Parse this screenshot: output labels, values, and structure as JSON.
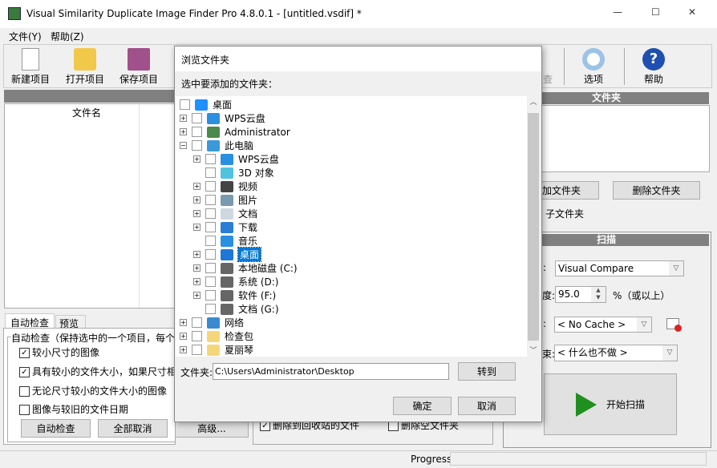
{
  "window": {
    "title": "Visual Similarity Duplicate Image Finder Pro 4.8.0.1 - [untitled.vsdif] *",
    "minimize": "—",
    "maximize": "☐",
    "close": "✕"
  },
  "menu": [
    "文件(Y)",
    "帮助(Z)"
  ],
  "toolbar": {
    "new": "新建项目",
    "open": "打开项目",
    "save": "保存项目",
    "check": "检查",
    "options": "选项",
    "help": "帮助"
  },
  "left": {
    "column_header": "文件名",
    "tabs": [
      "自动检查",
      "预览"
    ],
    "group_title": "自动检查（保持选中的一个项目，每个",
    "checks": [
      {
        "label": "较小尺寸的图像",
        "checked": true
      },
      {
        "label": "具有较小的文件大小，如果尺寸相",
        "checked": true
      },
      {
        "label": "无论尺寸较小的文件大小的图像",
        "checked": false
      },
      {
        "label": "图像与较旧的文件日期",
        "checked": false
      }
    ],
    "buttons": {
      "auto": "自动检查",
      "uncheck_all": "全部取消",
      "advanced": "高级..."
    }
  },
  "middle": {
    "checks": [
      {
        "label": "删除到回收站的文件",
        "checked": true
      },
      {
        "label": "删除空文件夹",
        "checked": false
      }
    ]
  },
  "right": {
    "folders_header": "文件夹",
    "add_folder": "加文件夹",
    "remove_folder": "删除文件夹",
    "subfolders": "子文件夹",
    "scan_header": "扫描",
    "method_label": ":",
    "method": "Visual Compare",
    "similarity_label": "度:",
    "similarity": "95.0",
    "similarity_suffix": "%（或以上）",
    "cache_label": ":",
    "cache": "< No Cache >",
    "after_label": "束:",
    "after": "< 什么也不做 >",
    "start": "开始扫描"
  },
  "status": {
    "progress": "Progress"
  },
  "dialog": {
    "title": "浏览文件夹",
    "prompt": "选中要添加的文件夹：",
    "folder_label": "文件夹:",
    "folder_value": "C:\\Users\\Administrator\\Desktop",
    "goto": "转到",
    "ok": "确定",
    "cancel": "取消",
    "tree": [
      {
        "label": "桌面",
        "level": 0,
        "exp": "",
        "icon": "#1e90ff"
      },
      {
        "label": "WPS云盘",
        "level": 0,
        "exp": "+",
        "icon": "#2a8fe0"
      },
      {
        "label": "Administrator",
        "level": 0,
        "exp": "+",
        "icon": "#4a8a4a"
      },
      {
        "label": "此电脑",
        "level": 0,
        "exp": "−",
        "icon": "#3a9ad9"
      },
      {
        "label": "WPS云盘",
        "level": 1,
        "exp": "+",
        "icon": "#2a8fe0"
      },
      {
        "label": "3D 对象",
        "level": 1,
        "exp": "",
        "icon": "#4fc3e0"
      },
      {
        "label": "视频",
        "level": 1,
        "exp": "+",
        "icon": "#444"
      },
      {
        "label": "图片",
        "level": 1,
        "exp": "+",
        "icon": "#7a9ab0"
      },
      {
        "label": "文档",
        "level": 1,
        "exp": "+",
        "icon": "#cfd8e0"
      },
      {
        "label": "下载",
        "level": 1,
        "exp": "+",
        "icon": "#2a7fd4"
      },
      {
        "label": "音乐",
        "level": 1,
        "exp": "",
        "icon": "#2a8fe0"
      },
      {
        "label": "桌面",
        "level": 1,
        "exp": "+",
        "icon": "#1e78d7",
        "selected": true
      },
      {
        "label": "本地磁盘 (C:)",
        "level": 1,
        "exp": "+",
        "icon": "#666"
      },
      {
        "label": "系统 (D:)",
        "level": 1,
        "exp": "+",
        "icon": "#666"
      },
      {
        "label": "软件 (F:)",
        "level": 1,
        "exp": "+",
        "icon": "#666"
      },
      {
        "label": "文档 (G:)",
        "level": 1,
        "exp": "",
        "icon": "#666"
      },
      {
        "label": "网络",
        "level": 0,
        "exp": "+",
        "icon": "#3a8ad0"
      },
      {
        "label": "检查包",
        "level": 0,
        "exp": "+",
        "icon": "#f5d77a"
      },
      {
        "label": "夏丽琴",
        "level": 0,
        "exp": "+",
        "icon": "#f5d77a"
      }
    ]
  }
}
